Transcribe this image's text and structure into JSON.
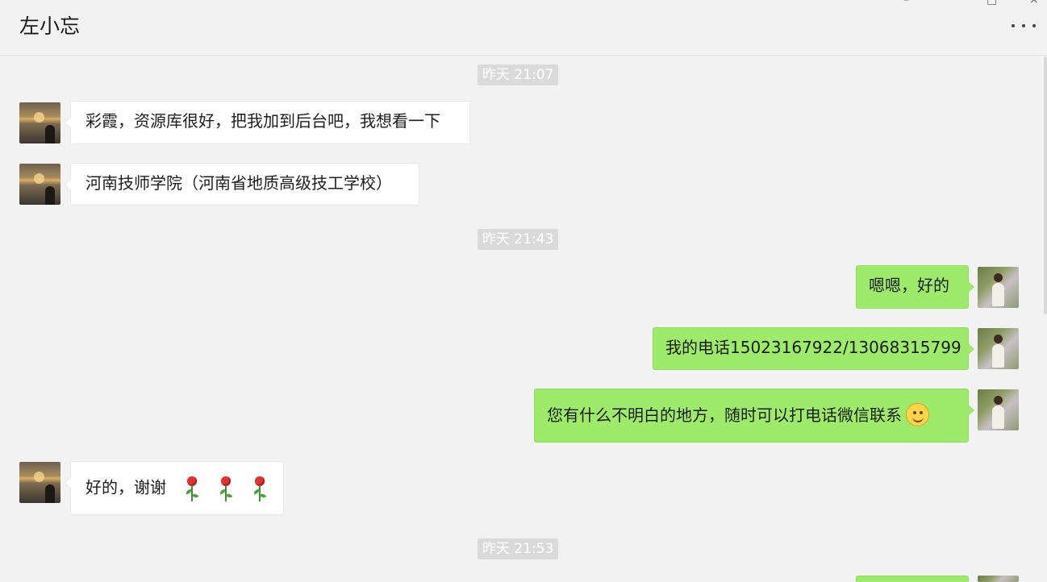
{
  "window": {
    "controls": {
      "minimize": "–",
      "maximize": "□",
      "close": "×"
    },
    "more_icon": "more-dots"
  },
  "chat": {
    "title": "左小忘",
    "times": [
      "昨天 21:07",
      "昨天 21:43",
      "昨天 21:53"
    ],
    "messages": [
      {
        "side": "incoming",
        "text": "彩霞，资源库很好，把我加到后台吧，我想看一下"
      },
      {
        "side": "incoming",
        "text": "河南技师学院（河南省地质高级技工学校）"
      },
      {
        "side": "outgoing",
        "text": "嗯嗯，好的"
      },
      {
        "side": "outgoing",
        "text": "我的电话15023167922/13068315799"
      },
      {
        "side": "outgoing",
        "text": "您有什么不明白的地方，随时可以打电话微信联系",
        "emoji": "smile-icon"
      },
      {
        "side": "incoming",
        "text": "好的，谢谢",
        "emoji": [
          "rose-icon",
          "rose-icon",
          "rose-icon"
        ]
      }
    ]
  },
  "colors": {
    "background": "#f2f2f2",
    "incoming_bubble": "#ffffff",
    "outgoing_bubble": "#9eea6a",
    "time_badge": "#dadada"
  }
}
